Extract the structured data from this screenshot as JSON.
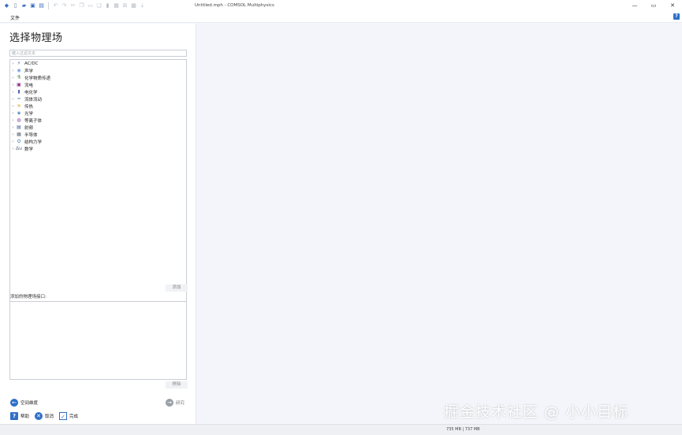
{
  "window": {
    "title": "Untitled.mph - COMSOL Multiphysics",
    "controls": {
      "minimize": "—",
      "restore": "▭",
      "close": "✕"
    }
  },
  "menu": {
    "file": "文件",
    "help_icon": "?"
  },
  "panel": {
    "title": "选择物理场",
    "filter_placeholder": "键入过滤文本",
    "tree_items": [
      {
        "label": "AC/DC",
        "icon": "acdc-icon"
      },
      {
        "label": "声学",
        "icon": "acoustics-icon"
      },
      {
        "label": "化学物质传递",
        "icon": "chemical-transport-icon"
      },
      {
        "label": "流电",
        "icon": "electrochemistry-icon"
      },
      {
        "label": "电化学",
        "icon": "battery-icon"
      },
      {
        "label": "流体流动",
        "icon": "fluid-flow-icon"
      },
      {
        "label": "传热",
        "icon": "heat-transfer-icon"
      },
      {
        "label": "光学",
        "icon": "optics-icon"
      },
      {
        "label": "等离子体",
        "icon": "plasma-icon"
      },
      {
        "label": "射频",
        "icon": "rf-icon"
      },
      {
        "label": "半导体",
        "icon": "semiconductor-icon"
      },
      {
        "label": "结构力学",
        "icon": "structural-icon"
      },
      {
        "label": "数学",
        "icon": "math-icon"
      }
    ],
    "add_label": "添加",
    "added_physics_label": "添加的物理场接口:",
    "remove_label": "移除"
  },
  "nav": {
    "back_label": "空间维度",
    "study_label": "研究"
  },
  "footer": {
    "help_label": "帮助",
    "cancel_label": "取消",
    "done_label": "完成"
  },
  "watermark": "掘金技术社区 @ 小小目标",
  "status": {
    "memory": "735 MB | 737 MB"
  }
}
